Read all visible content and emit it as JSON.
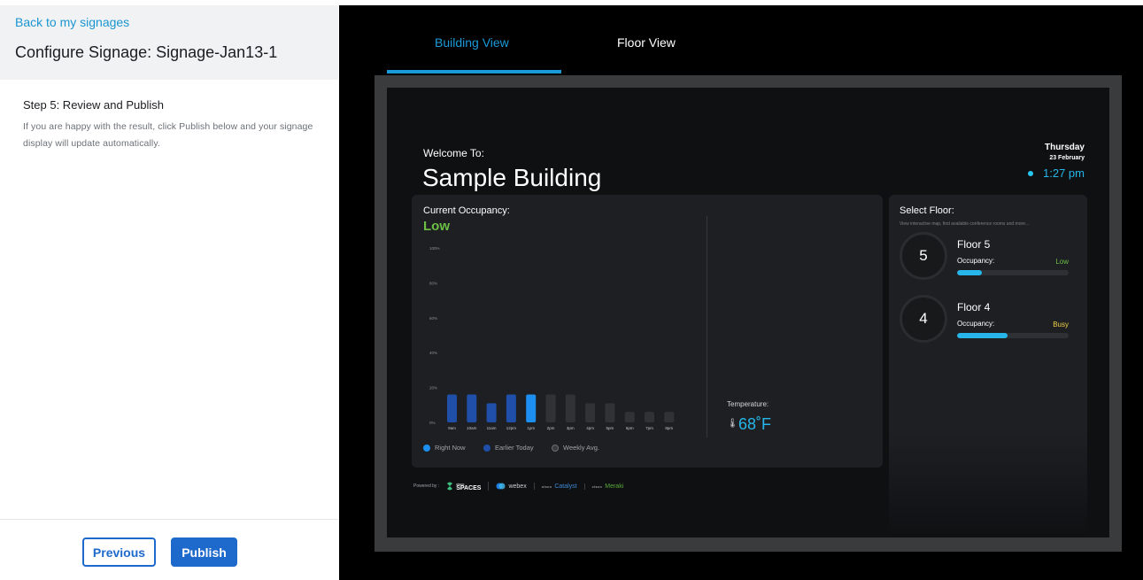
{
  "left_panel": {
    "back_link": "Back to my signages",
    "title": "Configure Signage: Signage-Jan13-1",
    "step_title": "Step 5: Review and Publish",
    "step_description": "If you are happy with the result, click Publish below and your signage display will update automatically.",
    "previous_label": "Previous",
    "publish_label": "Publish"
  },
  "preview": {
    "tabs": [
      {
        "label": "Building View",
        "active": true
      },
      {
        "label": "Floor View",
        "active": false
      }
    ],
    "welcome_label": "Welcome To:",
    "building_name": "Sample Building",
    "day": "Thursday",
    "date": "23 February",
    "time": "1:27 pm",
    "occupancy": {
      "title": "Current Occupancy:",
      "level": "Low",
      "level_color": "#6cbf45"
    },
    "temperature": {
      "label": "Temperature:",
      "value": "68˚F"
    },
    "legend": [
      {
        "label": "Right Now",
        "color": "#1d8ff0"
      },
      {
        "label": "Earlier Today",
        "color": "#1f4fa8"
      },
      {
        "label": "Weekly Avg.",
        "color": "#3a3c40"
      }
    ],
    "select_floor": {
      "title": "Select Floor:",
      "subtitle": "View interactive map, find available conference rooms and more...",
      "floors": [
        {
          "number": "5",
          "name": "Floor 5",
          "occupancy_label": "Occupancy:",
          "status": "Low",
          "status_color": "#6cbf45",
          "fill": 0.22
        },
        {
          "number": "4",
          "name": "Floor 4",
          "occupancy_label": "Occupancy:",
          "status": "Busy",
          "status_color": "#f1d243",
          "fill": 0.45
        }
      ]
    },
    "powered_by": {
      "label": "Powered by :",
      "brands": [
        {
          "name": "SPACES",
          "prefix": "cisco",
          "color": "#e8e9eb",
          "icon": "spaces-logo-icon"
        },
        {
          "name": "webex",
          "color": "#c9ccd0",
          "icon": "webex-logo-icon"
        },
        {
          "name": "Catalyst",
          "prefix": "cisco",
          "color": "#3e8ad6",
          "icon": "cisco-logo-icon"
        },
        {
          "name": "Meraki",
          "prefix": "cisco",
          "color": "#5aaa3a",
          "icon": "cisco-logo-icon"
        }
      ]
    }
  },
  "chart_data": {
    "type": "bar",
    "title": "Current Occupancy:",
    "categories": [
      "9am",
      "10am",
      "11am",
      "12pm",
      "1pm",
      "2pm",
      "3pm",
      "4pm",
      "5pm",
      "6pm",
      "7pm",
      "8pm"
    ],
    "series": [
      {
        "name": "Right Now",
        "values": [
          null,
          null,
          null,
          null,
          16,
          null,
          null,
          null,
          null,
          null,
          null,
          null
        ]
      },
      {
        "name": "Earlier Today",
        "values": [
          16,
          16,
          11,
          16,
          null,
          null,
          null,
          null,
          null,
          null,
          null,
          null
        ]
      },
      {
        "name": "Weekly Avg.",
        "values": [
          null,
          null,
          null,
          null,
          null,
          16,
          16,
          11,
          11,
          6,
          6,
          6
        ]
      }
    ],
    "y_ticks": [
      "0%",
      "20%",
      "40%",
      "60%",
      "80%",
      "100%"
    ],
    "ylim": [
      0,
      100
    ],
    "colors": {
      "Right Now": "#1d8ff0",
      "Earlier Today": "#1f4fa8",
      "Weekly Avg.": "#303236"
    },
    "grid": false,
    "legend_position": "bottom"
  }
}
